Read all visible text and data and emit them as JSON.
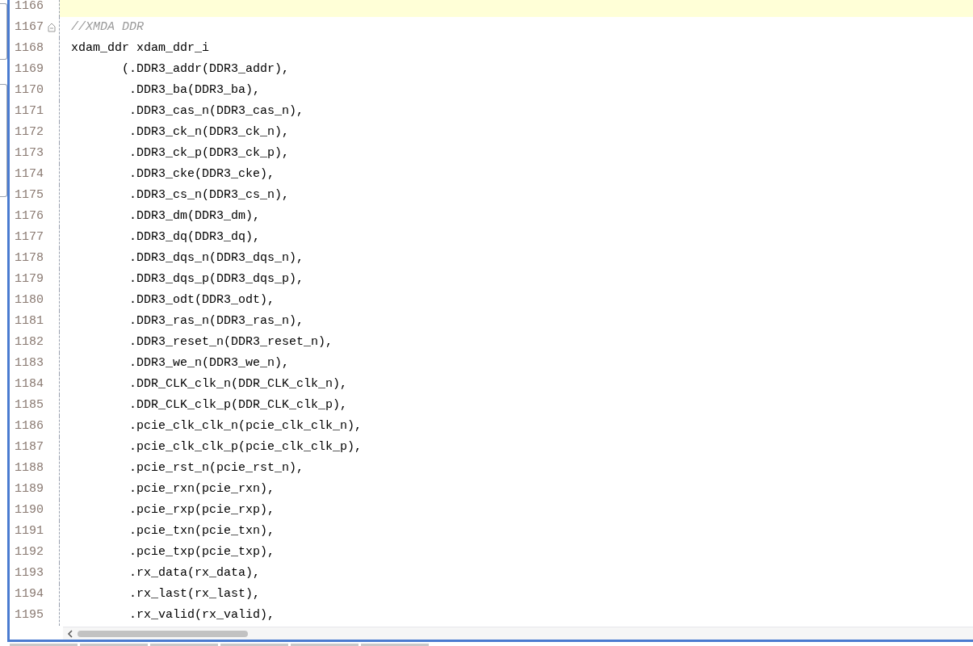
{
  "editor": {
    "lines": [
      {
        "number": "1166",
        "selected": true,
        "foldable": false
      },
      {
        "number": "1167",
        "text": "//XMDA DDR",
        "kind": "comment",
        "selected": false,
        "foldable": true
      },
      {
        "number": "1168",
        "text": "xdam_ddr xdam_ddr_i",
        "kind": "code",
        "selected": false,
        "foldable": false
      },
      {
        "number": "1169",
        "text": "       (.DDR3_addr(DDR3_addr),",
        "kind": "code",
        "selected": false,
        "foldable": false
      },
      {
        "number": "1170",
        "text": "        .DDR3_ba(DDR3_ba),",
        "kind": "code",
        "selected": false,
        "foldable": false
      },
      {
        "number": "1171",
        "text": "        .DDR3_cas_n(DDR3_cas_n),",
        "kind": "code",
        "selected": false,
        "foldable": false
      },
      {
        "number": "1172",
        "text": "        .DDR3_ck_n(DDR3_ck_n),",
        "kind": "code",
        "selected": false,
        "foldable": false
      },
      {
        "number": "1173",
        "text": "        .DDR3_ck_p(DDR3_ck_p),",
        "kind": "code",
        "selected": false,
        "foldable": false
      },
      {
        "number": "1174",
        "text": "        .DDR3_cke(DDR3_cke),",
        "kind": "code",
        "selected": false,
        "foldable": false
      },
      {
        "number": "1175",
        "text": "        .DDR3_cs_n(DDR3_cs_n),",
        "kind": "code",
        "selected": false,
        "foldable": false
      },
      {
        "number": "1176",
        "text": "        .DDR3_dm(DDR3_dm),",
        "kind": "code",
        "selected": false,
        "foldable": false
      },
      {
        "number": "1177",
        "text": "        .DDR3_dq(DDR3_dq),",
        "kind": "code",
        "selected": false,
        "foldable": false
      },
      {
        "number": "1178",
        "text": "        .DDR3_dqs_n(DDR3_dqs_n),",
        "kind": "code",
        "selected": false,
        "foldable": false
      },
      {
        "number": "1179",
        "text": "        .DDR3_dqs_p(DDR3_dqs_p),",
        "kind": "code",
        "selected": false,
        "foldable": false
      },
      {
        "number": "1180",
        "text": "        .DDR3_odt(DDR3_odt),",
        "kind": "code",
        "selected": false,
        "foldable": false
      },
      {
        "number": "1181",
        "text": "        .DDR3_ras_n(DDR3_ras_n),",
        "kind": "code",
        "selected": false,
        "foldable": false
      },
      {
        "number": "1182",
        "text": "        .DDR3_reset_n(DDR3_reset_n),",
        "kind": "code",
        "selected": false,
        "foldable": false
      },
      {
        "number": "1183",
        "text": "        .DDR3_we_n(DDR3_we_n),",
        "kind": "code",
        "selected": false,
        "foldable": false
      },
      {
        "number": "1184",
        "text": "        .DDR_CLK_clk_n(DDR_CLK_clk_n),",
        "kind": "code",
        "selected": false,
        "foldable": false
      },
      {
        "number": "1185",
        "text": "        .DDR_CLK_clk_p(DDR_CLK_clk_p),",
        "kind": "code",
        "selected": false,
        "foldable": false
      },
      {
        "number": "1186",
        "text": "        .pcie_clk_clk_n(pcie_clk_clk_n),",
        "kind": "code",
        "selected": false,
        "foldable": false
      },
      {
        "number": "1187",
        "text": "        .pcie_clk_clk_p(pcie_clk_clk_p),",
        "kind": "code",
        "selected": false,
        "foldable": false
      },
      {
        "number": "1188",
        "text": "        .pcie_rst_n(pcie_rst_n),",
        "kind": "code",
        "selected": false,
        "foldable": false
      },
      {
        "number": "1189",
        "text": "        .pcie_rxn(pcie_rxn),",
        "kind": "code",
        "selected": false,
        "foldable": false
      },
      {
        "number": "1190",
        "text": "        .pcie_rxp(pcie_rxp),",
        "kind": "code",
        "selected": false,
        "foldable": false
      },
      {
        "number": "1191",
        "text": "        .pcie_txn(pcie_txn),",
        "kind": "code",
        "selected": false,
        "foldable": false
      },
      {
        "number": "1192",
        "text": "        .pcie_txp(pcie_txp),",
        "kind": "code",
        "selected": false,
        "foldable": false
      },
      {
        "number": "1193",
        "text": "        .rx_data(rx_data),",
        "kind": "code",
        "selected": false,
        "foldable": false
      },
      {
        "number": "1194",
        "text": "        .rx_last(rx_last),",
        "kind": "code",
        "selected": false,
        "foldable": false
      },
      {
        "number": "1195",
        "text": "        .rx_valid(rx_valid),",
        "kind": "code",
        "selected": false,
        "foldable": false
      }
    ]
  }
}
